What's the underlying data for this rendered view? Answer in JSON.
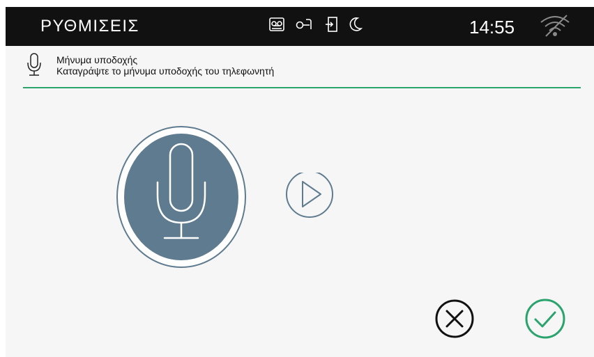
{
  "header": {
    "title": "ΡΥΘΜΙΣΕΙΣ",
    "time": "14:55",
    "status_icons": [
      "voicemail-icon",
      "key-icon",
      "door-exit-icon",
      "moon-icon"
    ],
    "wifi_icon": "wifi-off-icon"
  },
  "section": {
    "icon": "microphone-icon",
    "title": "Μήνυμα υποδοχής",
    "subtitle": "Καταγράψτε το μήνυμα υποδοχής του τηλεφωνητή"
  },
  "controls": {
    "record_icon": "microphone-icon",
    "play_icon": "play-icon",
    "cancel_icon": "close-circle-icon",
    "confirm_icon": "check-circle-icon"
  },
  "colors": {
    "topbar": "#111111",
    "accent_green": "#2aa36d",
    "record_fill": "#5e7b8f",
    "background": "#f6f6f6"
  }
}
